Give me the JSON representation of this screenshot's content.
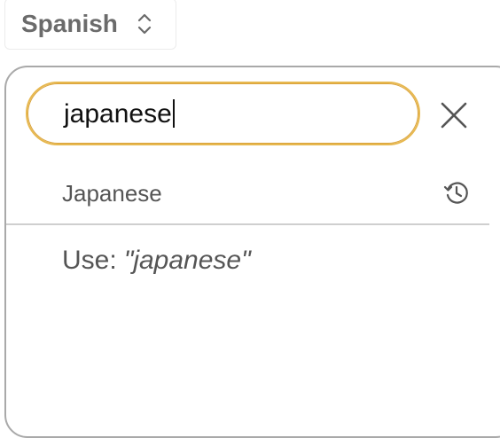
{
  "language_select": {
    "selected": "Spanish",
    "icon": "up-down-chevron-icon"
  },
  "search": {
    "value": "japanese"
  },
  "close": {
    "icon": "close-icon"
  },
  "suggestions": [
    {
      "label": "Japanese",
      "icon": "history-icon"
    }
  ],
  "custom_entry": {
    "prefix": "Use:",
    "quoted_value": "\"japanese\""
  },
  "colors": {
    "focus_ring": "#e7b84f",
    "text": "#555555",
    "border": "#a9a9a9"
  }
}
